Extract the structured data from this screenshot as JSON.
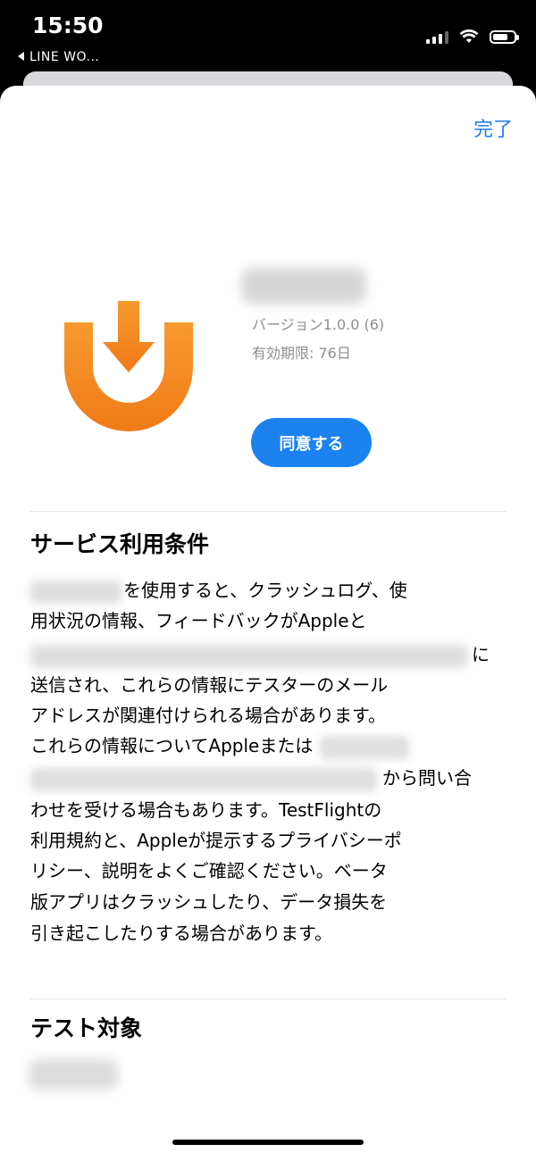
{
  "status_bar": {
    "time": "15:50",
    "back_app": "LINE WO..."
  },
  "header": {
    "done_label": "完了"
  },
  "app": {
    "icon": "testflight-download-icon",
    "icon_color": "#F58A1F",
    "version": "バージョン1.0.0 (6)",
    "expiry": "有効期限: 76日",
    "agree_label": "同意する"
  },
  "terms": {
    "title": "サービス利用条件",
    "lines": [
      "を使用すると、クラッシュログ、使",
      "用状況の情報、フィードバックがAppleと",
      "に",
      "送信され、これらの情報にテスターのメール",
      "アドレスが関連付けられる場合があります。",
      "これらの情報についてAppleまたは",
      "から問い合",
      "わせを受ける場合もあります。TestFlightの",
      "利用規約と、Appleが提示するプライバシーポ",
      "リシー、説明をよくご確認ください。ベータ",
      "版アプリはクラッシュしたり、データ損失を",
      "引き起こしたりする場合があります。"
    ]
  },
  "test_target": {
    "title": "テスト対象"
  },
  "colors": {
    "accent": "#1E7CF2",
    "button": "#1B82F0"
  }
}
